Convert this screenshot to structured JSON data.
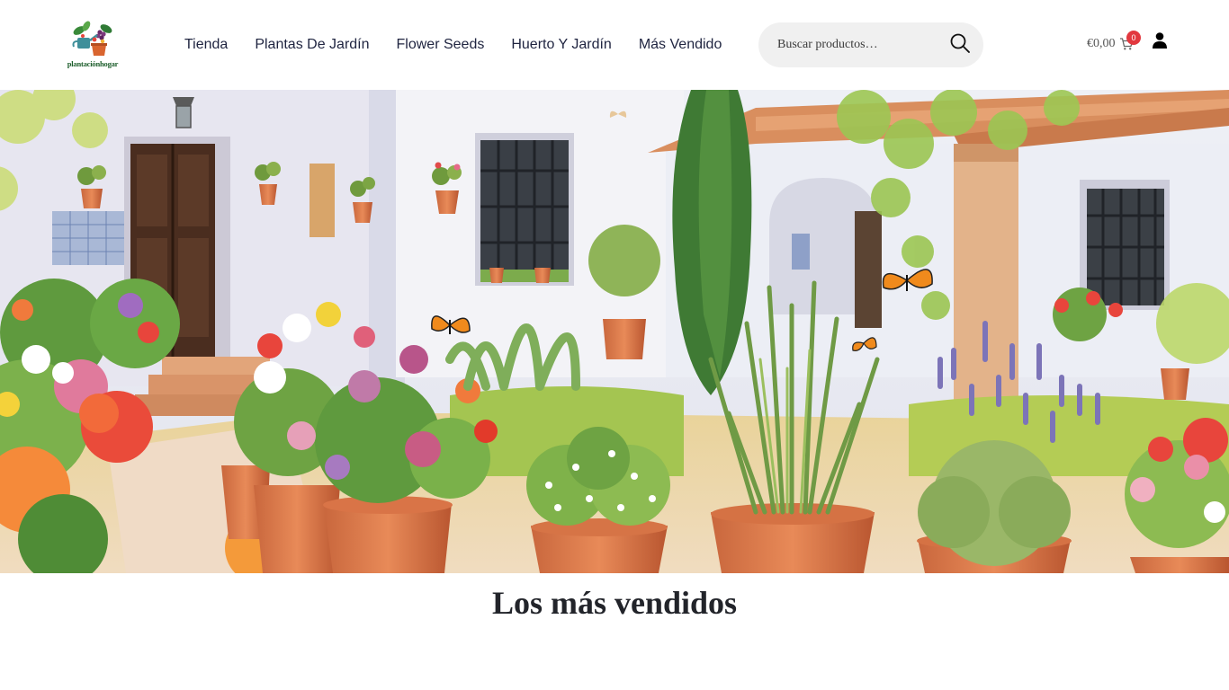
{
  "brand": {
    "name": "plantaciónhogar"
  },
  "nav": {
    "items": [
      {
        "label": "Tienda"
      },
      {
        "label": "Plantas De Jardín"
      },
      {
        "label": "Flower Seeds"
      },
      {
        "label": "Huerto Y Jardín"
      },
      {
        "label": "Más Vendido"
      }
    ]
  },
  "search": {
    "placeholder": "Buscar productos…"
  },
  "cart": {
    "total": "€0,00",
    "count": "0"
  },
  "hero": {
    "alt": "Patio andaluz con macetas de flores, romero y lavanda"
  },
  "section": {
    "title": "Los más vendidos"
  },
  "colors": {
    "badge": "#e2383f",
    "search_bg": "#f0f0f0",
    "brand_green": "#1d5e2c"
  },
  "icons": {
    "search": "search-icon",
    "cart": "cart-icon",
    "user": "user-icon"
  }
}
